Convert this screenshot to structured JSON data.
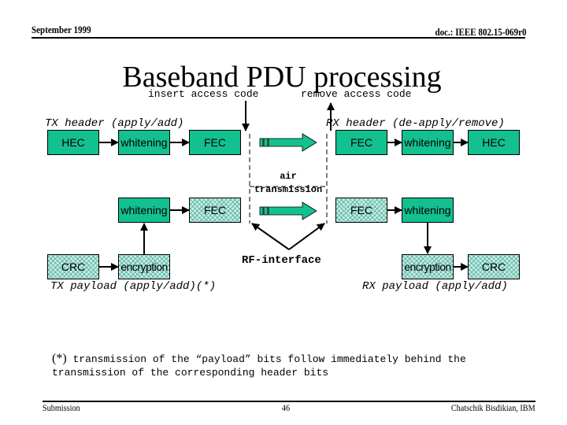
{
  "header": {
    "date": "September 1999",
    "doc_id": "doc.: IEEE 802.15-069r0"
  },
  "title": "Baseband PDU processing",
  "labels": {
    "insert_access_code": "insert access code",
    "remove_access_code": "remove access code",
    "tx_header": "TX header (apply/add)",
    "rx_header": "RX header (de-apply/remove)",
    "air_transmission_line1": "air",
    "air_transmission_line2": "transmission",
    "rf_interface": "RF-interface",
    "tx_payload": "TX payload (apply/add)(*)",
    "rx_payload": "RX payload (apply/add)"
  },
  "tx_header_blocks": [
    {
      "label": "HEC",
      "style": "solid"
    },
    {
      "label": "whitening",
      "style": "solid"
    },
    {
      "label": "FEC",
      "style": "solid"
    }
  ],
  "rx_header_blocks": [
    {
      "label": "FEC",
      "style": "solid"
    },
    {
      "label": "whitening",
      "style": "solid"
    },
    {
      "label": "HEC",
      "style": "solid"
    }
  ],
  "tx_payload_blocks": {
    "whitening": {
      "label": "whitening",
      "style": "solid"
    },
    "fec": {
      "label": "FEC",
      "style": "hatched"
    },
    "crc": {
      "label": "CRC",
      "style": "hatched"
    },
    "encryption": {
      "label": "encryption",
      "style": "hatched"
    }
  },
  "rx_payload_blocks": {
    "fec": {
      "label": "FEC",
      "style": "hatched"
    },
    "whitening": {
      "label": "whitening",
      "style": "solid"
    },
    "encryption": {
      "label": "encryption",
      "style": "hatched"
    },
    "crc": {
      "label": "CRC",
      "style": "hatched"
    }
  },
  "footnote": {
    "marker": "(*)",
    "line1": "transmission of the “payload” bits follow immediately behind the",
    "line2": "transmission of the corresponding header bits"
  },
  "footer": {
    "left": "Submission",
    "page": "46",
    "author": "Chatschik Bisdikian, IBM"
  },
  "colors": {
    "block_fill": "#13c08f",
    "hatch_fill": "#c8ece4"
  }
}
